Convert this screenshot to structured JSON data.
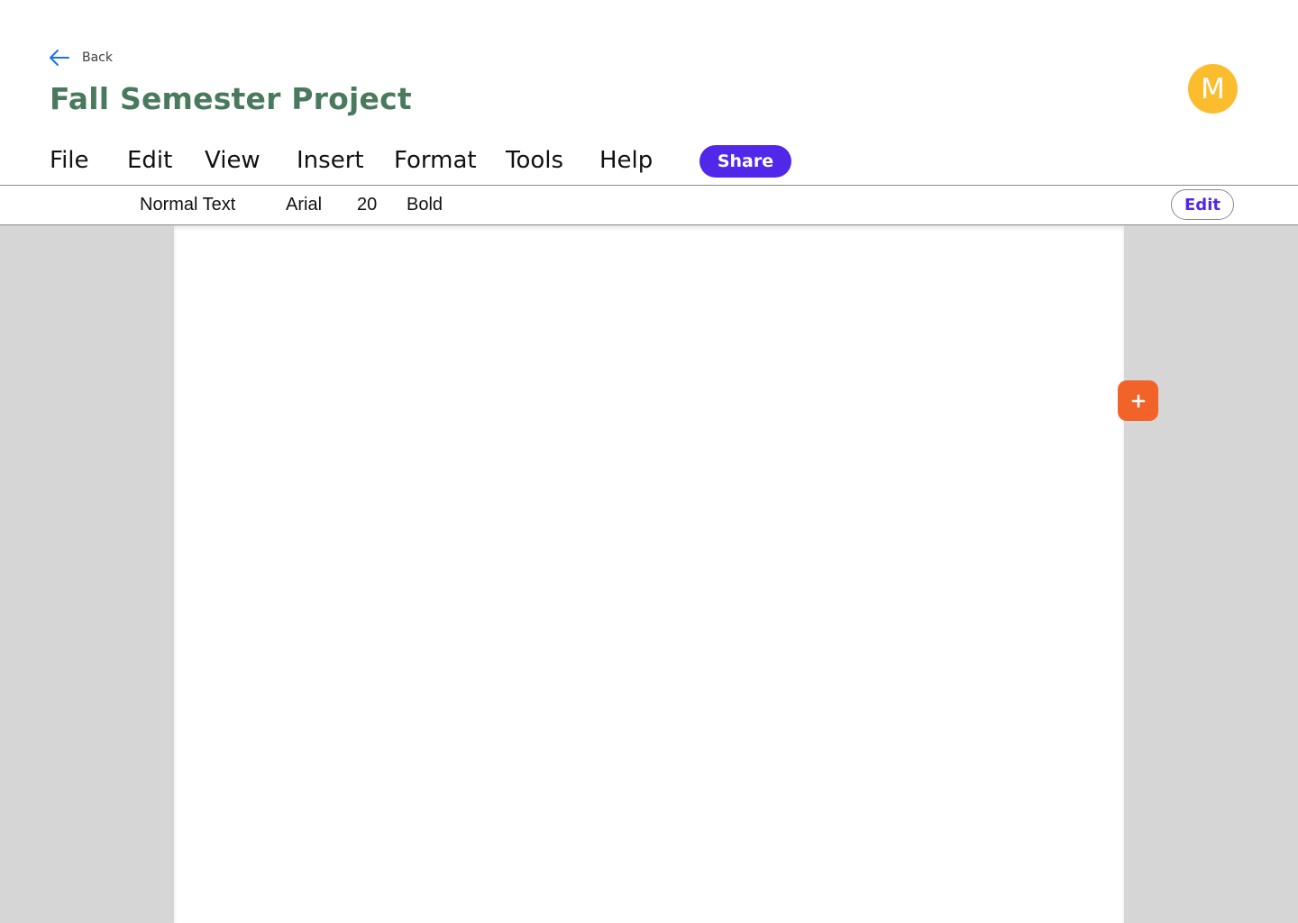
{
  "header": {
    "back_label": "Back",
    "title": "Fall Semester Project",
    "avatar_initial": "M"
  },
  "menu": {
    "items": [
      {
        "label": "File"
      },
      {
        "label": "Edit"
      },
      {
        "label": "View"
      },
      {
        "label": "Insert"
      },
      {
        "label": "Format"
      },
      {
        "label": "Tools"
      },
      {
        "label": "Help"
      }
    ],
    "share_label": "Share"
  },
  "format_toolbar": {
    "style": "Normal Text",
    "font": "Arial",
    "size": "20",
    "weight": "Bold",
    "edit_label": "Edit"
  },
  "icons": {
    "back": "arrow-left-icon",
    "add": "plus-icon"
  },
  "colors": {
    "title": "#4a7a5e",
    "accent": "#5128ea",
    "avatar": "#fbbd2e",
    "add_button": "#f2632a",
    "back_arrow": "#1a73e8",
    "workspace": "#d6d6d6"
  }
}
